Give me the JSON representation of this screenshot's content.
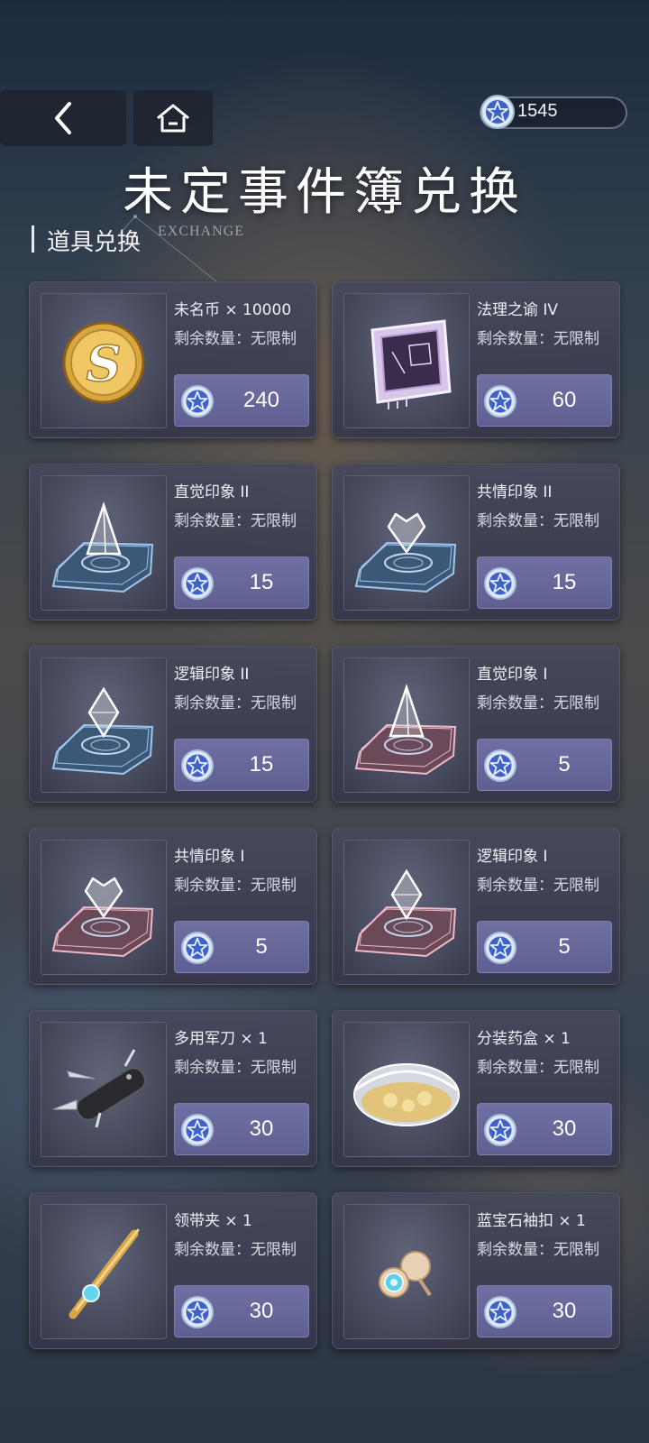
{
  "header": {
    "title": "未定事件簿兑换",
    "currency_value": "1545",
    "back_icon": "chevron-left-icon",
    "home_icon": "home-icon"
  },
  "section": {
    "title": "道具兑换",
    "subtitle": "EXCHANGE"
  },
  "colors": {
    "card_bg": "#464a5e",
    "price_button": "#6565a0",
    "star_coin": "#3f62c8"
  },
  "items": [
    {
      "name": "未名币 × 10000",
      "stock": "剩余数量：无限制",
      "price": "240",
      "icon": "gold-coin-icon"
    },
    {
      "name": "法理之谕 IV",
      "stock": "剩余数量：无限制",
      "price": "60",
      "icon": "chip-icon"
    },
    {
      "name": "直觉印象 II",
      "stock": "剩余数量：无限制",
      "price": "15",
      "icon": "blue-pyramid-impression-icon"
    },
    {
      "name": "共情印象 II",
      "stock": "剩余数量：无限制",
      "price": "15",
      "icon": "blue-heart-impression-icon"
    },
    {
      "name": "逻辑印象 II",
      "stock": "剩余数量：无限制",
      "price": "15",
      "icon": "blue-diamond-impression-icon"
    },
    {
      "name": "直觉印象 I",
      "stock": "剩余数量：无限制",
      "price": "5",
      "icon": "pink-pyramid-impression-icon"
    },
    {
      "name": "共情印象 I",
      "stock": "剩余数量：无限制",
      "price": "5",
      "icon": "pink-heart-impression-icon"
    },
    {
      "name": "逻辑印象 I",
      "stock": "剩余数量：无限制",
      "price": "5",
      "icon": "pink-diamond-impression-icon"
    },
    {
      "name": "多用军刀 × 1",
      "stock": "剩余数量：无限制",
      "price": "30",
      "icon": "pocket-knife-icon"
    },
    {
      "name": "分装药盒 × 1",
      "stock": "剩余数量：无限制",
      "price": "30",
      "icon": "pill-case-icon"
    },
    {
      "name": "领带夹 × 1",
      "stock": "剩余数量：无限制",
      "price": "30",
      "icon": "tie-clip-icon"
    },
    {
      "name": "蓝宝石袖扣 × 1",
      "stock": "剩余数量：无限制",
      "price": "30",
      "icon": "sapphire-cufflinks-icon"
    }
  ]
}
